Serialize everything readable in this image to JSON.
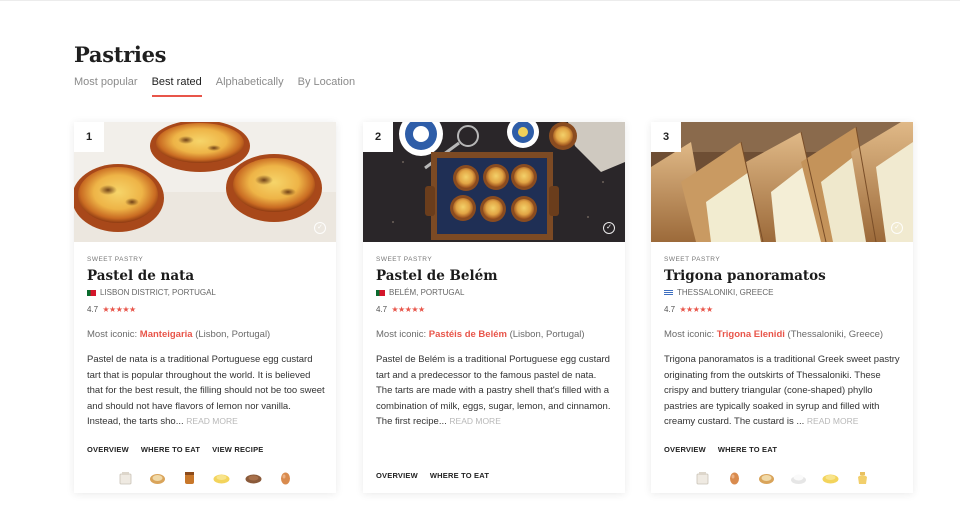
{
  "header": {
    "title": "Pastries"
  },
  "tabs": [
    {
      "label": "Most popular"
    },
    {
      "label": "Best rated"
    },
    {
      "label": "Alphabetically"
    },
    {
      "label": "By Location"
    }
  ],
  "active_tab": "Best rated",
  "colors": {
    "accent": "#e8554a"
  },
  "cards": [
    {
      "rank": "1",
      "category": "SWEET PASTRY",
      "name": "Pastel de nata",
      "location": "LISBON DISTRICT, PORTUGAL",
      "flag": "portugal-flag",
      "rating": "4.7",
      "stars": "★★★★★",
      "iconic_prefix": "Most iconic: ",
      "iconic_place": "Manteigaria",
      "iconic_suffix": " (Lisbon, Portugal)",
      "description": "Pastel de nata is a traditional Portuguese egg custard tart that is popular throughout the world. It is believed that for the best result, the filling should not be too sweet and should not have flavors of lemon nor vanilla. Instead, the tarts sho...",
      "read_more": "READ MORE",
      "links": [
        "OVERVIEW",
        "WHERE TO EAT",
        "VIEW RECIPE"
      ],
      "ingredients": [
        "sugar-icon",
        "bread-icon",
        "honey-jar-icon",
        "butter-icon",
        "chocolate-icon",
        "egg-icon"
      ]
    },
    {
      "rank": "2",
      "category": "SWEET PASTRY",
      "name": "Pastel de Belém",
      "location": "BELÉM, PORTUGAL",
      "flag": "portugal-flag",
      "rating": "4.7",
      "stars": "★★★★★",
      "iconic_prefix": "Most iconic: ",
      "iconic_place": "Pastéis de Belém",
      "iconic_suffix": " (Lisbon, Portugal)",
      "description": "Pastel de Belém is a traditional Portuguese egg custard tart and a predecessor to the famous pastel de nata. The tarts are made with a pastry shell that's filled with a combination of milk, eggs, sugar, lemon, and cinnamon. The first recipe...",
      "read_more": "READ MORE",
      "links": [
        "OVERVIEW",
        "WHERE TO EAT"
      ],
      "ingredients": []
    },
    {
      "rank": "3",
      "category": "SWEET PASTRY",
      "name": "Trigona panoramatos",
      "location": "THESSALONIKI, GREECE",
      "flag": "greece-flag",
      "rating": "4.7",
      "stars": "★★★★★",
      "iconic_prefix": "Most iconic: ",
      "iconic_place": "Trigona Elenidi",
      "iconic_suffix": " (Thessaloniki, Greece)",
      "description": "Trigona panoramatos is a traditional Greek sweet pastry originating from the outskirts of Thessaloniki. These crispy and buttery triangular (cone-shaped) phyllo pastries are typically soaked in syrup and filled with creamy custard. The custard is ...",
      "read_more": "READ MORE",
      "links": [
        "OVERVIEW",
        "WHERE TO EAT"
      ],
      "ingredients": [
        "sugar-icon",
        "egg-icon",
        "bread-icon",
        "flour-bowl-icon",
        "butter-icon",
        "syrup-icon"
      ]
    }
  ]
}
